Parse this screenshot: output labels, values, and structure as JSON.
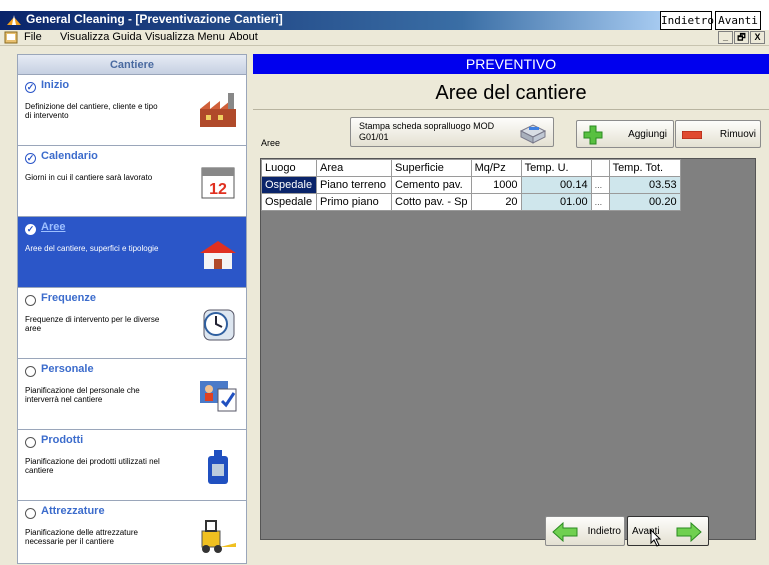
{
  "window": {
    "title": "General Cleaning - [Preventivazione Cantieri]",
    "nav_back": "Indietro",
    "nav_next": "Avanti"
  },
  "menu": [
    "File",
    "Visualizza Guida",
    "Visualizza Menu",
    "About"
  ],
  "winctrl": [
    "_",
    "Ƨ",
    "X"
  ],
  "sidebar": {
    "header": "Cantiere",
    "steps": [
      {
        "title": "Inizio",
        "desc": "Definizione del cantiere, cliente e tipo di intervento",
        "checked": true,
        "icon": "factory-icon"
      },
      {
        "title": "Calendario",
        "desc": "Giorni in cui il cantiere sarà lavorato",
        "checked": true,
        "icon": "calendar-icon",
        "calendar_day": "12"
      },
      {
        "title": "Aree",
        "desc": "Aree del cantiere, superfici e tipologie",
        "checked": true,
        "icon": "buildings-icon"
      },
      {
        "title": "Frequenze",
        "desc": "Frequenze di intervento per le diverse aree",
        "checked": false,
        "icon": "clock-icon"
      },
      {
        "title": "Personale",
        "desc": "Pianificazione del personale che interverrà nel cantiere",
        "checked": false,
        "icon": "personnel-icon"
      },
      {
        "title": "Prodotti",
        "desc": "Pianificazione dei prodotti utilizzati nel cantiere",
        "checked": false,
        "icon": "bottle-icon"
      },
      {
        "title": "Attrezzature",
        "desc": "Pianificazione delle attrezzature necessarie per il cantiere",
        "checked": false,
        "icon": "forklift-icon"
      }
    ]
  },
  "main": {
    "banner": "PREVENTIVO",
    "title": "Aree del cantiere",
    "aree_label": "Aree",
    "print_label": "Stampa scheda sopralluogo MOD G01/01",
    "add_label": "Aggiungi",
    "remove_label": "Rimuovi",
    "columns": [
      "Luogo",
      "Area",
      "Superficie",
      "Mq/Pz",
      "Temp. U.",
      "",
      "Temp. Tot."
    ],
    "rows": [
      {
        "luogo": "Ospedale",
        "area": "Piano terreno",
        "superficie": "Cemento pav.",
        "mq": "1000",
        "temp_u": "00.14",
        "dots": "...",
        "temp_tot": "03.53"
      },
      {
        "luogo": "Ospedale",
        "area": "Primo piano",
        "superficie": "Cotto pav. - Sp",
        "mq": "20",
        "temp_u": "01.00",
        "dots": "...",
        "temp_tot": "00.20"
      }
    ],
    "back_label": "Indietro",
    "next_label": "Avanti"
  },
  "colors": {
    "banner": "#0000ee",
    "selected_step": "#2b56c8",
    "grid_bg": "#808080",
    "time_cell": "#cfe6ec"
  }
}
